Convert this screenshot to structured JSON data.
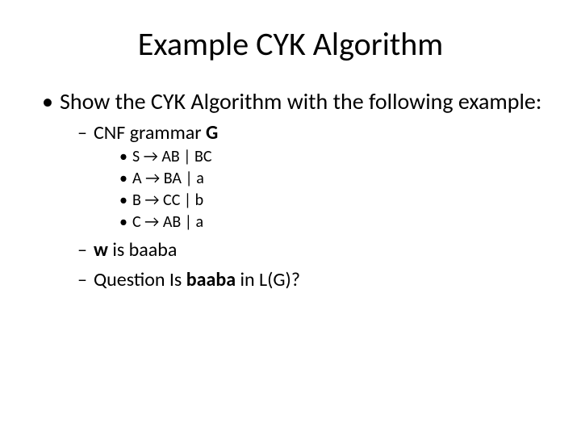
{
  "title": "Example CYK Algorithm",
  "bullet_main": "Show the CYK Algorithm with the following example:",
  "sub_cnf_prefix": "CNF grammar ",
  "sub_cnf_bold": "G",
  "rules": {
    "r1": "S → AB | BC",
    "r2": "A → BA | a",
    "r3": "B → CC | b",
    "r4": "C → AB | a"
  },
  "w_line_bold": "w",
  "w_line_rest": " is baaba",
  "q_prefix": "Question Is ",
  "q_bold": "baaba",
  "q_suffix": " in L(G)?"
}
